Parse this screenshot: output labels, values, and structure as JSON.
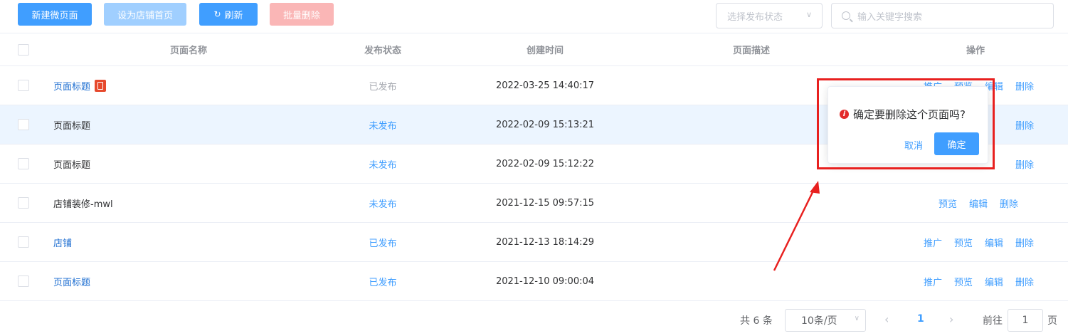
{
  "toolbar": {
    "new_page": "新建微页面",
    "set_home": "设为店铺首页",
    "refresh": "刷新",
    "batch_delete": "批量删除"
  },
  "filter": {
    "status_placeholder": "选择发布状态",
    "search_placeholder": "输入关键字搜索"
  },
  "columns": {
    "name": "页面名称",
    "status": "发布状态",
    "created": "创建时间",
    "desc": "页面描述",
    "ops": "操作"
  },
  "rows": [
    {
      "name": "页面标题",
      "status": "已发布",
      "created": "2022-03-25 14:40:17",
      "ops": [
        "推广",
        "预览",
        "编辑",
        "删除"
      ]
    },
    {
      "name": "页面标题",
      "status": "未发布",
      "created": "2022-02-09 15:13:21",
      "ops": [
        "删除"
      ]
    },
    {
      "name": "页面标题",
      "status": "未发布",
      "created": "2022-02-09 15:12:22",
      "ops": [
        "删除"
      ]
    },
    {
      "name": "店铺装修-mwl",
      "status": "未发布",
      "created": "2021-12-15 09:57:15",
      "ops": [
        "预览",
        "编辑",
        "删除"
      ]
    },
    {
      "name": "店铺",
      "status": "已发布",
      "created": "2021-12-13 18:14:29",
      "ops": [
        "推广",
        "预览",
        "编辑",
        "删除"
      ]
    },
    {
      "name": "页面标题",
      "status": "已发布",
      "created": "2021-12-10 09:00:04",
      "ops": [
        "推广",
        "预览",
        "编辑",
        "删除"
      ]
    }
  ],
  "pagination": {
    "total": "共 6 条",
    "page_size": "10条/页",
    "current": "1",
    "goto_label": "前往",
    "goto_value": "1",
    "goto_unit": "页"
  },
  "popconfirm": {
    "message": "确定要删除这个页面吗?",
    "cancel": "取消",
    "confirm": "确定"
  },
  "colors": {
    "primary": "#409eff",
    "annotation_red": "#e8201f"
  }
}
